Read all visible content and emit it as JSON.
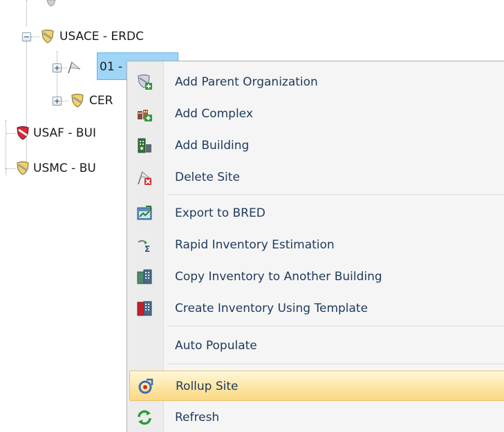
{
  "tree": {
    "nodes": [
      {
        "id": "usace",
        "label": "USACE - ERDC",
        "expanded": true,
        "icon": "shield-icon"
      },
      {
        "id": "site01",
        "label": "01 -",
        "expanded": false,
        "icon": "flag-icon",
        "selected": true
      },
      {
        "id": "cer",
        "label": "CER",
        "expanded": false,
        "icon": "shield-icon"
      },
      {
        "id": "usaf",
        "label": "USAF - BUI",
        "icon": "shield-icon"
      },
      {
        "id": "usmc",
        "label": "USMC - BU",
        "icon": "shield-icon"
      }
    ]
  },
  "context_menu": {
    "items": [
      {
        "id": "add-parent-organization",
        "label": "Add Parent Organization",
        "icon": "add-organization-icon"
      },
      {
        "id": "add-complex",
        "label": "Add Complex",
        "icon": "add-complex-icon"
      },
      {
        "id": "add-building",
        "label": "Add Building",
        "icon": "add-building-icon"
      },
      {
        "id": "delete-site",
        "label": "Delete Site",
        "icon": "delete-site-icon"
      },
      {
        "id": "export-to-bred",
        "label": "Export to BRED",
        "icon": "export-icon"
      },
      {
        "id": "rapid-inventory-estimation",
        "label": "Rapid Inventory Estimation",
        "icon": "rapid-estimation-icon"
      },
      {
        "id": "copy-inventory",
        "label": "Copy Inventory to Another Building",
        "icon": "copy-inventory-icon"
      },
      {
        "id": "create-inventory-template",
        "label": "Create Inventory Using Template",
        "icon": "template-inventory-icon"
      },
      {
        "id": "auto-populate",
        "label": "Auto Populate",
        "icon": ""
      },
      {
        "id": "rollup-site",
        "label": "Rollup Site",
        "icon": "rollup-icon",
        "highlighted": true
      },
      {
        "id": "refresh",
        "label": "Refresh",
        "icon": "refresh-icon"
      }
    ]
  },
  "colors": {
    "menu_text": "#1e395b",
    "selection_fill": "#9fd6f7",
    "hover_fill": "#fde5a5",
    "shield_gold": "#e8c14a",
    "shield_red": "#c8102e"
  }
}
